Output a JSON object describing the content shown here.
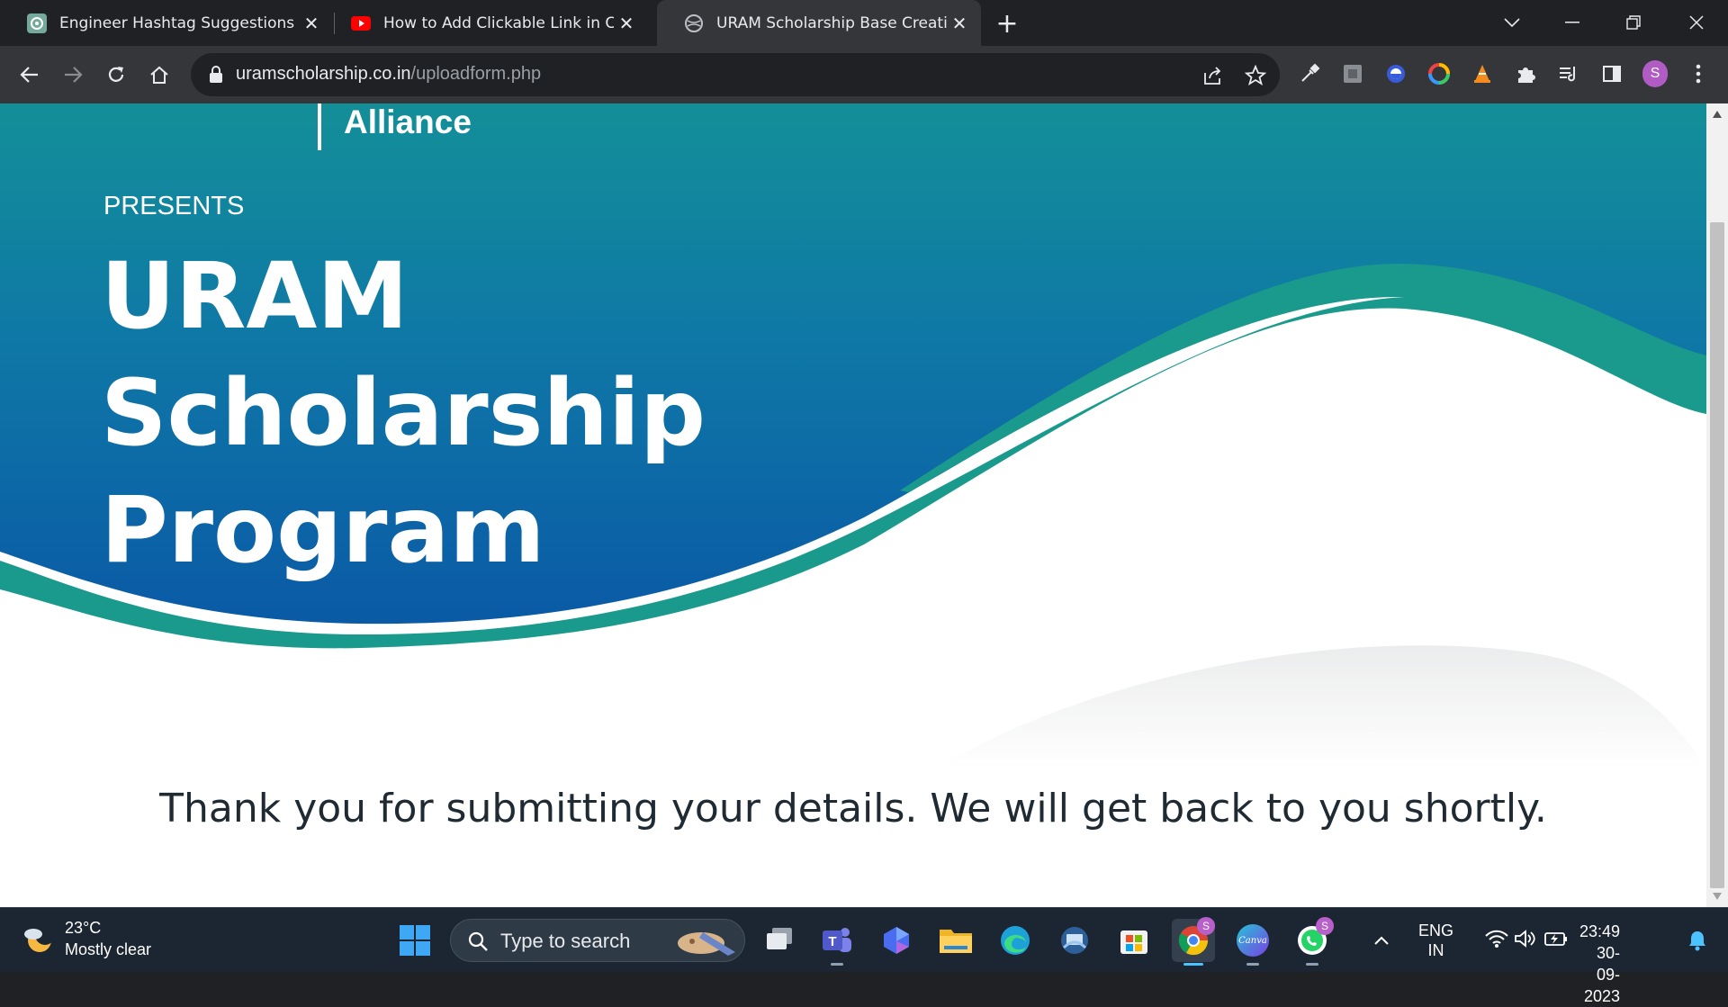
{
  "browser": {
    "tabs": [
      {
        "title": "Engineer Hashtag Suggestions",
        "icon": "chatgpt-icon",
        "active": false
      },
      {
        "title": "How to Add Clickable Link in Canva",
        "icon": "youtube-icon",
        "active": false
      },
      {
        "title": "URAM Scholarship Base Creative",
        "icon": "globe-icon",
        "active": true
      }
    ],
    "new_tab_label": "+",
    "url_host": "uramscholarship.co.in",
    "url_path": "/uploadform.php",
    "profile_initial": "S"
  },
  "page": {
    "brand_alliance": "Alliance",
    "presents": "PRESENTS",
    "title_lines": [
      "URAM",
      "Scholarship",
      "Program"
    ],
    "thank_you": "Thank you for submitting your details. We will get back to you shortly.",
    "colors": {
      "hero_top": "#138f98",
      "hero_bottom": "#0a5aa6",
      "wave_teal": "#1a9a8c"
    }
  },
  "taskbar": {
    "weather_temp": "23°C",
    "weather_desc": "Mostly clear",
    "search_placeholder": "Type to search",
    "lang_primary": "ENG",
    "lang_secondary": "IN",
    "time": "23:49",
    "date": "30-09-2023",
    "chrome_badge": "S",
    "whatsapp_badge": "S",
    "canva_label": "Canva"
  }
}
